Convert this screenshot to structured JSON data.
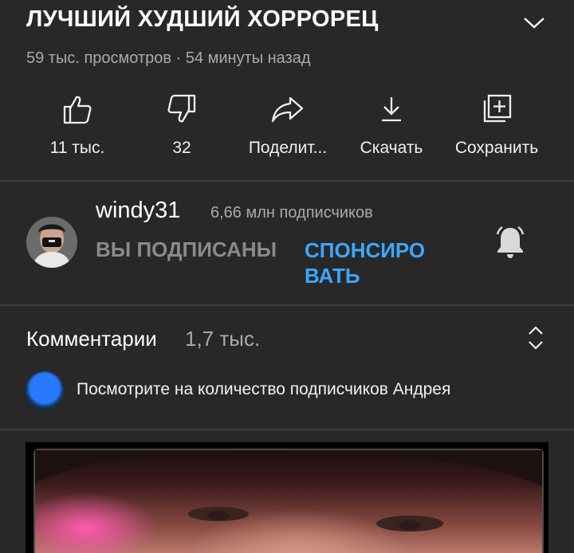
{
  "video": {
    "title": "ЛУЧШИЙ ХУДШИЙ ХОРРОРЕЦ",
    "meta": "59 тыс. просмотров · 54 минуты назад"
  },
  "actions": [
    {
      "label": "11 тыс.",
      "icon": "thumb-up-icon"
    },
    {
      "label": "32",
      "icon": "thumb-down-icon"
    },
    {
      "label": "Поделит...",
      "icon": "share-icon"
    },
    {
      "label": "Скачать",
      "icon": "download-icon"
    },
    {
      "label": "Сохранить",
      "icon": "save-playlist-icon"
    }
  ],
  "channel": {
    "name": "windy31",
    "subscribers": "6,66 млн подписчиков",
    "subscribed_label": "ВЫ ПОДПИСАНЫ",
    "sponsor_label": "СПОНСИРО ВАТЬ",
    "bell_icon": "notification-bell-icon"
  },
  "comments": {
    "title": "Комментарии",
    "count": "1,7 тыс.",
    "preview_text": "Посмотрите на количество подписчиков Андрея"
  },
  "colors": {
    "background": "#282828",
    "accent": "#3ea6ff",
    "secondary_text": "#aaaaaa"
  }
}
